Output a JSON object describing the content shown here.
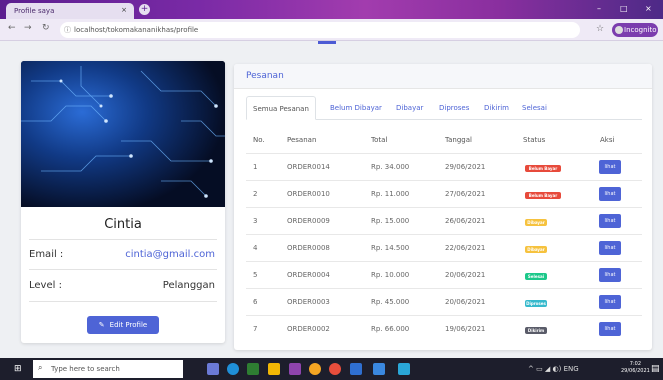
{
  "browser": {
    "tab_title": "Profile saya",
    "tab_close": "×",
    "new_tab": "+",
    "url": "localhost/tokomakananikhas/profile",
    "profile_label": "Incognito",
    "controls": {
      "minimize": "–",
      "maximize": "□",
      "close": "×"
    }
  },
  "profile": {
    "name": "Cintia",
    "email_label": "Email :",
    "email": "cintia@gmail.com",
    "level_label": "Level :",
    "level": "Pelanggan",
    "edit_button": "Edit Profile",
    "email_color": "#4e64d6"
  },
  "orders": {
    "title": "Pesanan",
    "tabs": [
      "Semua Pesanan",
      "Belum Dibayar",
      "Dibayar",
      "Diproses",
      "Dikirim",
      "Selesai"
    ],
    "columns": [
      "No.",
      "Pesanan",
      "Total",
      "Tanggal",
      "Status",
      "Aksi"
    ],
    "rows": [
      {
        "no": "1",
        "order": "ORDER0014",
        "total": "Rp. 34.000",
        "date": "29/06/2021",
        "status": "Belum Bayar",
        "color": "#e74a3b",
        "action": "lihat"
      },
      {
        "no": "2",
        "order": "ORDER0010",
        "total": "Rp. 11.000",
        "date": "27/06/2021",
        "status": "Belum Bayar",
        "color": "#e74a3b",
        "action": "lihat"
      },
      {
        "no": "3",
        "order": "ORDER0009",
        "total": "Rp. 15.000",
        "date": "26/06/2021",
        "status": "Dibayar",
        "color": "#f6c23e",
        "action": "lihat"
      },
      {
        "no": "4",
        "order": "ORDER0008",
        "total": "Rp. 14.500",
        "date": "22/06/2021",
        "status": "Dibayar",
        "color": "#f6c23e",
        "action": "lihat"
      },
      {
        "no": "5",
        "order": "ORDER0004",
        "total": "Rp. 10.000",
        "date": "20/06/2021",
        "status": "Selesai",
        "color": "#1cc88a",
        "action": "lihat"
      },
      {
        "no": "6",
        "order": "ORDER0003",
        "total": "Rp. 45.000",
        "date": "20/06/2021",
        "status": "Diproses",
        "color": "#36b9cc",
        "action": "lihat"
      },
      {
        "no": "7",
        "order": "ORDER0002",
        "total": "Rp. 66.000",
        "date": "19/06/2021",
        "status": "Dikirim",
        "color": "#5a5c69",
        "action": "lihat"
      }
    ]
  },
  "taskbar": {
    "search_placeholder": "Type here to search",
    "tray_lang": "ENG",
    "time": "7:02",
    "date": "29/06/2021"
  }
}
